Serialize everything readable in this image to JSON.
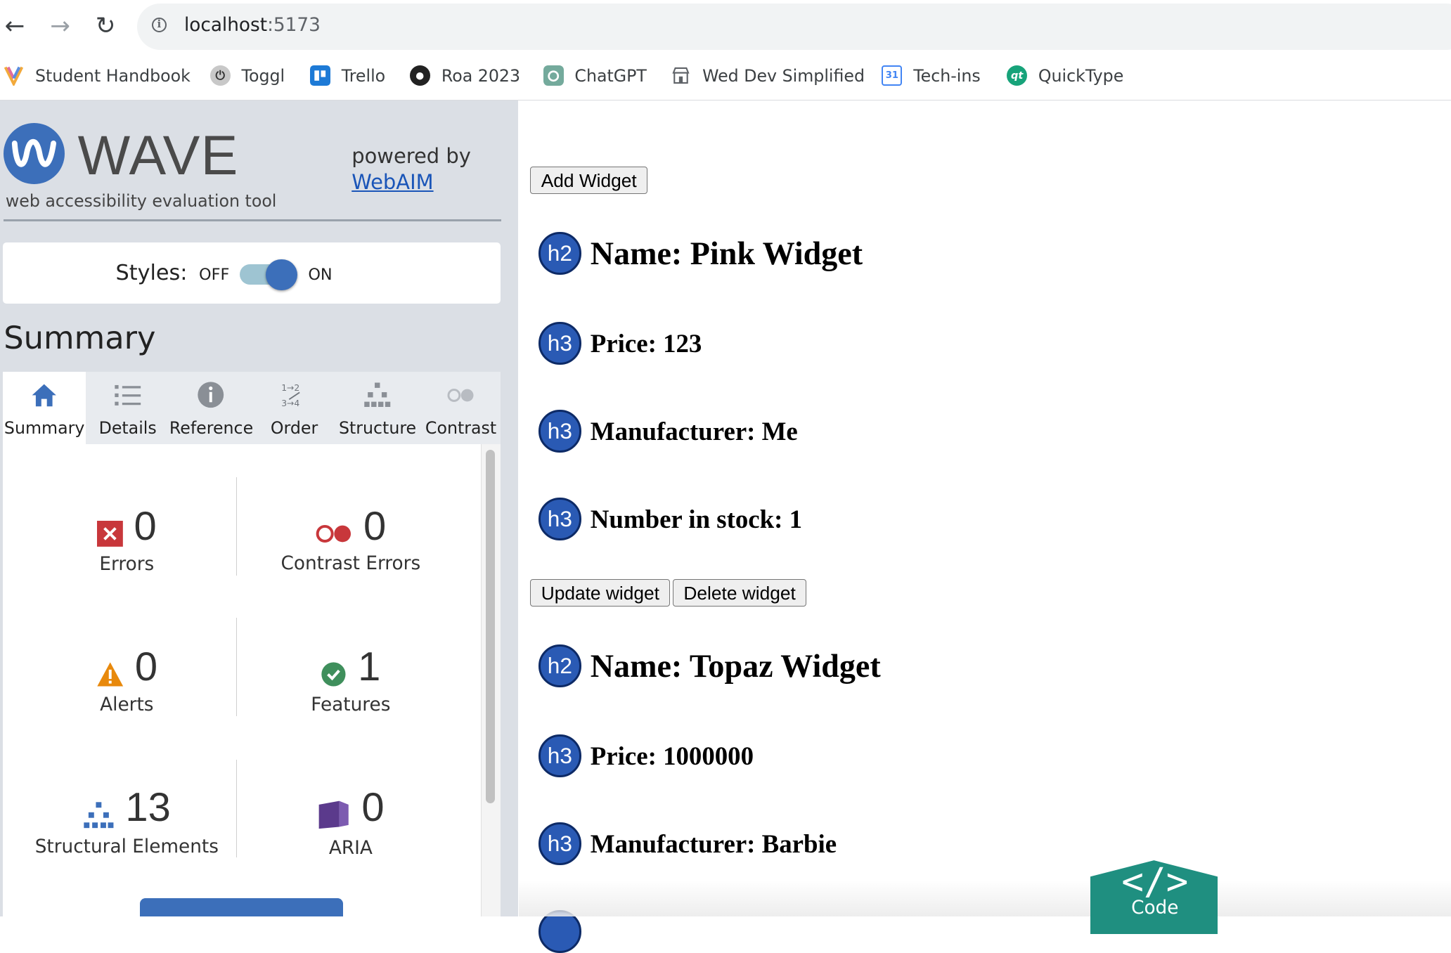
{
  "browser": {
    "url_host": "localhost",
    "url_port": ":5173",
    "bookmarks": [
      {
        "label": "Student Handbook",
        "icon": "handbook-icon"
      },
      {
        "label": "Toggl",
        "icon": "toggl-icon"
      },
      {
        "label": "Trello",
        "icon": "trello-icon"
      },
      {
        "label": "Roa 2023",
        "icon": "github-icon"
      },
      {
        "label": "ChatGPT",
        "icon": "chatgpt-icon"
      },
      {
        "label": "Wed Dev Simplified",
        "icon": "store-icon"
      },
      {
        "label": "Tech-ins",
        "icon": "calendar-icon",
        "badge": "31"
      },
      {
        "label": "QuickType",
        "icon": "quicktype-icon",
        "badge": "qt"
      }
    ]
  },
  "wave": {
    "title": "WAVE",
    "subtitle": "web accessibility evaluation tool",
    "powered_by": "powered by",
    "webaim": "WebAIM",
    "styles_label": "Styles:",
    "styles_off": "OFF",
    "styles_on": "ON",
    "styles_enabled": true,
    "summary_heading": "Summary",
    "tabs": [
      {
        "label": "Summary",
        "icon": "home-icon",
        "active": true
      },
      {
        "label": "Details",
        "icon": "list-icon",
        "active": false
      },
      {
        "label": "Reference",
        "icon": "info-icon",
        "active": false
      },
      {
        "label": "Order",
        "icon": "order-icon",
        "active": false
      },
      {
        "label": "Structure",
        "icon": "structure-icon",
        "active": false
      },
      {
        "label": "Contrast",
        "icon": "contrast-icon",
        "active": false
      }
    ],
    "stats": {
      "errors": {
        "count": "0",
        "label": "Errors"
      },
      "contrast_errors": {
        "count": "0",
        "label": "Contrast Errors"
      },
      "alerts": {
        "count": "0",
        "label": "Alerts"
      },
      "features": {
        "count": "1",
        "label": "Features"
      },
      "structural": {
        "count": "13",
        "label": "Structural Elements"
      },
      "aria": {
        "count": "0",
        "label": "ARIA"
      }
    }
  },
  "page": {
    "add_widget": "Add Widget",
    "update_widget": "Update widget",
    "delete_widget": "Delete widget",
    "widgets": [
      {
        "name": "Name: Pink Widget",
        "price": "Price: 123",
        "manufacturer": "Manufacturer: Me",
        "stock": "Number in stock: 1"
      },
      {
        "name": "Name: Topaz Widget",
        "price": "Price: 1000000",
        "manufacturer": "Manufacturer: Barbie"
      }
    ],
    "heading_badges": {
      "h2": "h2",
      "h3": "h3"
    },
    "code_symbol": "</>",
    "code_label": "Code"
  },
  "colors": {
    "wave_blue": "#3c6fba",
    "heading_badge": "#2a5ab4",
    "code_badge": "#1f8f80",
    "error_red": "#c8373b",
    "alert_orange": "#e8890c",
    "feature_green": "#3f8f5c",
    "aria_purple": "#5b3a8c"
  }
}
